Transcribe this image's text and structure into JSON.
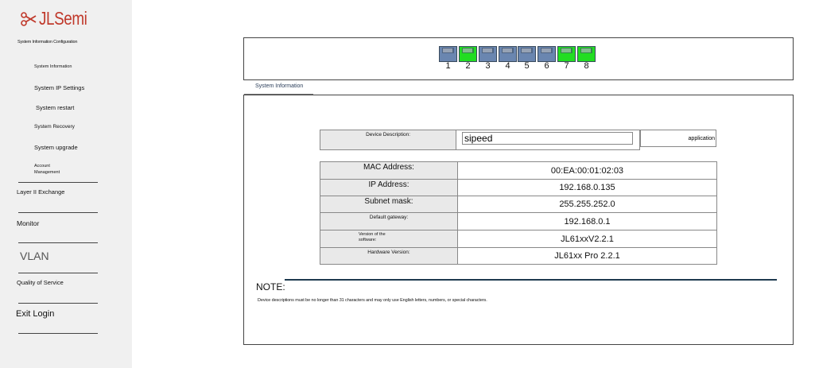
{
  "sidebar": {
    "logo_text": "JLSemi",
    "section_title": "System Information Configuration",
    "items": [
      {
        "label": "System Information"
      },
      {
        "label": "System IP Settings"
      },
      {
        "label": "System restart"
      },
      {
        "label": "System Recovery"
      },
      {
        "label": "System upgrade"
      },
      {
        "label": "Account Management"
      }
    ],
    "menus": [
      {
        "label": "Layer II Exchange"
      },
      {
        "label": "Monitor"
      },
      {
        "label": "VLAN"
      },
      {
        "label": "Quality of Service"
      },
      {
        "label": "Exit Login"
      }
    ]
  },
  "ports": [
    {
      "number": "1",
      "status": "down",
      "color": "#6a86b0"
    },
    {
      "number": "2",
      "status": "up",
      "color": "#22dd22"
    },
    {
      "number": "3",
      "status": "down",
      "color": "#6a86b0"
    },
    {
      "number": "4",
      "status": "down",
      "color": "#6a86b0"
    },
    {
      "number": "5",
      "status": "down",
      "color": "#6a86b0"
    },
    {
      "number": "6",
      "status": "down",
      "color": "#6a86b0"
    },
    {
      "number": "7",
      "status": "up",
      "color": "#22dd22"
    },
    {
      "number": "8",
      "status": "up",
      "color": "#22dd22"
    }
  ],
  "tab": {
    "label": "System Information"
  },
  "device": {
    "label": "Device Description:",
    "value": "sipeed",
    "apply_label": "application"
  },
  "info": [
    {
      "label": "MAC Address:",
      "value": "00:EA:00:01:02:03"
    },
    {
      "label": "IP Address:",
      "value": "192.168.0.135"
    },
    {
      "label": "Subnet mask:",
      "value": "255.255.252.0"
    },
    {
      "label": "Default gateway:",
      "value": "192.168.0.1"
    },
    {
      "label": "Version of the software:",
      "value": "JL61xxV2.2.1"
    },
    {
      "label": "Hardware Version:",
      "value": "JL61xx Pro 2.2.1"
    }
  ],
  "note": {
    "title": "NOTE:",
    "text": "Device descriptions must be no longer than 31 characters and may only use English letters, numbers, or special characters."
  },
  "colors": {
    "accent": "#c0392b",
    "port_up": "#22dd22",
    "port_down": "#6a86b0",
    "note_line": "#1e3a4f"
  }
}
